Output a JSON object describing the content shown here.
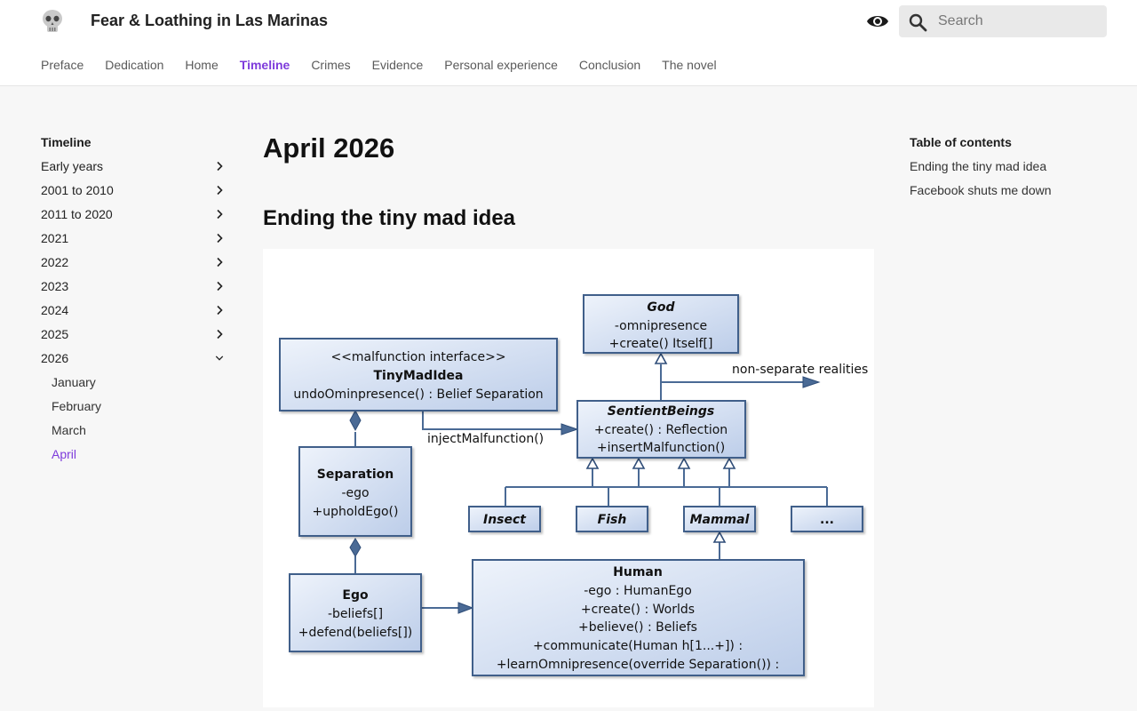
{
  "header": {
    "site_title": "Fear & Loathing in Las Marinas",
    "search_placeholder": "Search",
    "tabs": [
      {
        "label": "Preface"
      },
      {
        "label": "Dedication"
      },
      {
        "label": "Home"
      },
      {
        "label": "Timeline",
        "active": true
      },
      {
        "label": "Crimes"
      },
      {
        "label": "Evidence"
      },
      {
        "label": "Personal experience"
      },
      {
        "label": "Conclusion"
      },
      {
        "label": "The novel"
      }
    ]
  },
  "sidebar": {
    "heading": "Timeline",
    "items": [
      {
        "label": "Early years",
        "state": "collapsed"
      },
      {
        "label": "2001 to 2010",
        "state": "collapsed"
      },
      {
        "label": "2011 to 2020",
        "state": "collapsed"
      },
      {
        "label": "2021",
        "state": "collapsed"
      },
      {
        "label": "2022",
        "state": "collapsed"
      },
      {
        "label": "2023",
        "state": "collapsed"
      },
      {
        "label": "2024",
        "state": "collapsed"
      },
      {
        "label": "2025",
        "state": "collapsed"
      },
      {
        "label": "2026",
        "state": "expanded"
      }
    ],
    "subitems": [
      {
        "label": "January"
      },
      {
        "label": "February"
      },
      {
        "label": "March"
      },
      {
        "label": "April",
        "active": true
      }
    ]
  },
  "main": {
    "title": "April 2026",
    "section_title": "Ending the tiny mad idea"
  },
  "diagram": {
    "god": {
      "title": "God",
      "lines": [
        "-omnipresence",
        "+create() Itself[]"
      ]
    },
    "tiny": {
      "stereotype": "<<malfunction interface>>",
      "title": "TinyMadIdea",
      "lines": [
        "undoOminpresence() : Belief Separation"
      ]
    },
    "sentient": {
      "title": "SentientBeings",
      "lines": [
        "+create() : Reflection",
        "+insertMalfunction()"
      ]
    },
    "separation": {
      "title": "Separation",
      "lines": [
        "-ego",
        "+upholdEgo()"
      ]
    },
    "insect": "Insect",
    "fish": "Fish",
    "mammal": "Mammal",
    "more": "...",
    "ego": {
      "title": "Ego",
      "lines": [
        "-beliefs[]",
        "+defend(beliefs[])"
      ]
    },
    "human": {
      "title": "Human",
      "lines": [
        "-ego : HumanEgo",
        "+create() : Worlds",
        "+believe() : Beliefs",
        "+communicate(Human h[1...+]) :",
        "+learnOmnipresence(override Separation()) :"
      ]
    },
    "label_non_separate": "non-separate realities",
    "label_inject": "injectMalfunction()"
  },
  "toc": {
    "heading": "Table of contents",
    "items": [
      {
        "label": "Ending the tiny mad idea"
      },
      {
        "label": "Facebook shuts me down"
      }
    ]
  },
  "colors": {
    "accent": "#7e3bdb",
    "uml_border": "#3f5f8a",
    "uml_fill": "#d7e2f4"
  }
}
